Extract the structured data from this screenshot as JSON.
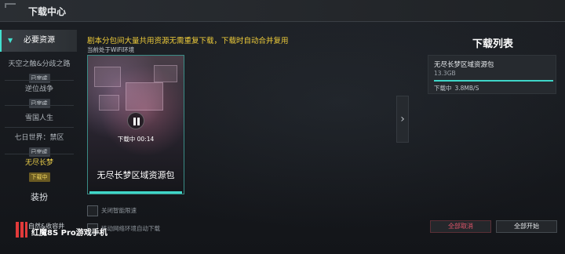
{
  "window": {
    "title": "下载中心"
  },
  "sidebar": {
    "top": {
      "label": "必要资源"
    },
    "items": [
      {
        "label": "天空之触&分歧之路",
        "badge": "已完成"
      },
      {
        "label": "逆位战争",
        "badge": "已完成"
      },
      {
        "label": "雪国人生",
        "badge": ""
      },
      {
        "label": "七日世界：禁区",
        "badge": "已完成"
      },
      {
        "label": "无尽长梦",
        "badge": "下载中"
      }
    ],
    "section": {
      "label": "装扮"
    },
    "bottom_label": "自然&收容井"
  },
  "main": {
    "notice": "剧本分包间大量共用资源无需重复下载，下载时自动合并复用",
    "wifi_status": "当前处于WiFi环境",
    "card": {
      "status_text": "下载中 00:14",
      "name": "无尽长梦区域资源包",
      "progress": 1.0
    },
    "options": [
      {
        "label": "关闭智能限速"
      },
      {
        "label": "移动网络环境自动下载"
      }
    ]
  },
  "download_list": {
    "title": "下载列表",
    "items": [
      {
        "name": "无尽长梦区域资源包",
        "size": "13.3GB",
        "status": "下载中",
        "speed": "3.8MB/S",
        "progress": 1.0
      }
    ],
    "cancel_all": "全部取消",
    "start_all": "全部开始"
  },
  "watermark": {
    "text": "红魔8S Pro游戏手机"
  },
  "colors": {
    "accent": "#3fd6c8",
    "notice": "#f0cd3a",
    "danger": "#e0556a"
  }
}
